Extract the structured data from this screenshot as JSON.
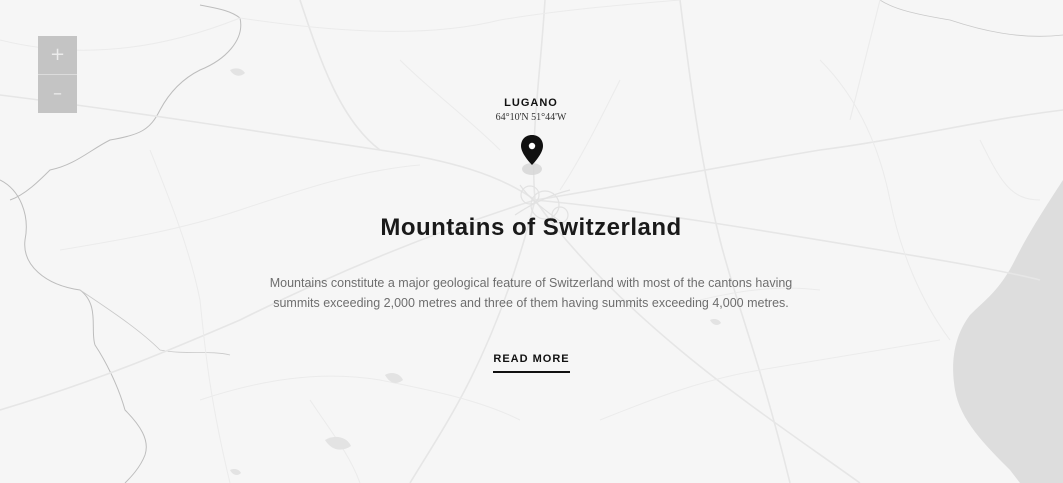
{
  "map": {
    "zoom_in_label": "+",
    "zoom_out_label": "–",
    "water_color": "#dddddd",
    "road_color": "#e9e9e9",
    "border_color": "#bdbdbd"
  },
  "location": {
    "name": "LUGANO",
    "coordinates": "64°10'N 51°44'W",
    "marker_icon": "map-pin-icon"
  },
  "content": {
    "title": "Mountains of Switzerland",
    "description": "Mountains constitute a major geological feature of Switzerland with most of the cantons having summits exceeding 2,000 metres and three of them having summits exceeding 4,000 metres.",
    "cta_label": "READ MORE"
  }
}
